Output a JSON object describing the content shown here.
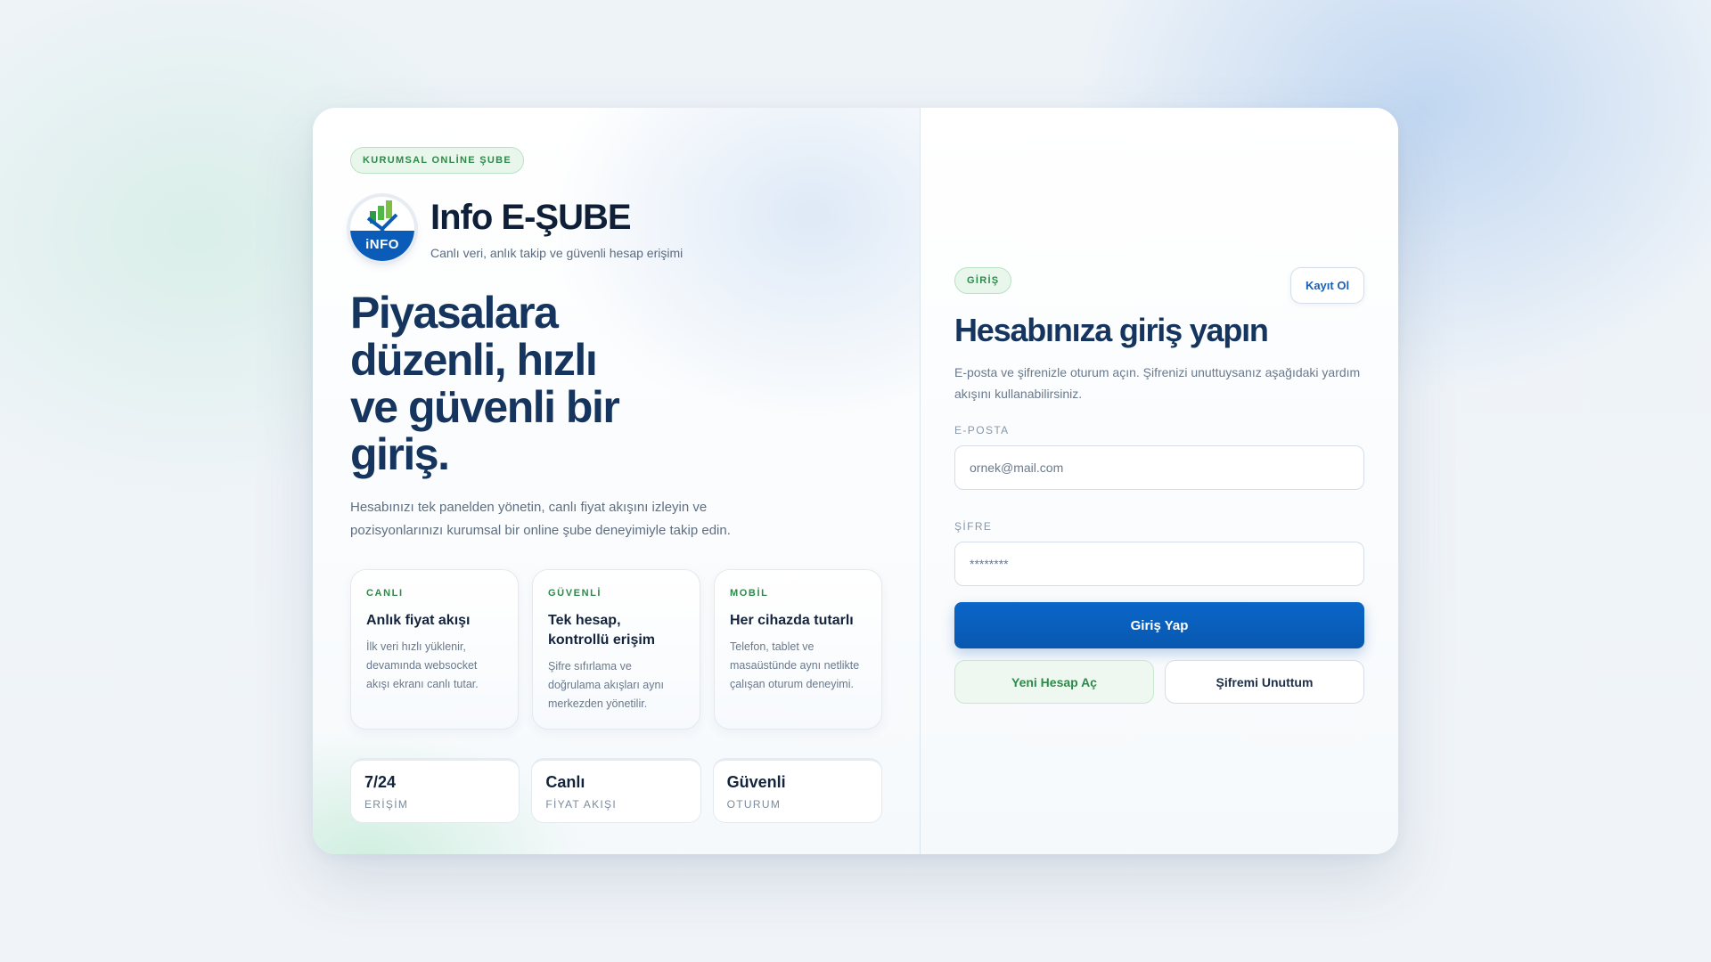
{
  "left": {
    "badge": "KURUMSAL ONLİNE ŞUBE",
    "brand": {
      "logo_text": "iNFO",
      "title": "Info E-ŞUBE",
      "subtitle": "Canlı veri, anlık takip ve güvenli hesap erişimi"
    },
    "hero_lines": [
      "Piyasalara",
      "düzenli, hızlı",
      "ve güvenli bir",
      "giriş."
    ],
    "lead": "Hesabınızı tek panelden yönetin, canlı fiyat akışını izleyin ve pozisyonlarınızı kurumsal bir online şube deneyimiyle takip edin.",
    "features": [
      {
        "tag": "CANLI",
        "title": "Anlık fiyat akışı",
        "desc": "İlk veri hızlı yüklenir, devamında websocket akışı ekranı canlı tutar."
      },
      {
        "tag": "GÜVENLİ",
        "title": "Tek hesap, kontrollü erişim",
        "desc": "Şifre sıfırlama ve doğrulama akışları aynı merkezden yönetilir."
      },
      {
        "tag": "MOBİL",
        "title": "Her cihazda tutarlı",
        "desc": "Telefon, tablet ve masaüstünde aynı netlikte çalışan oturum deneyimi."
      }
    ],
    "stats": [
      {
        "value": "7/24",
        "label": "ERİŞİM"
      },
      {
        "value": "Canlı",
        "label": "FİYAT AKIŞI"
      },
      {
        "value": "Güvenli",
        "label": "OTURUM"
      }
    ]
  },
  "form": {
    "badge": "GİRİŞ",
    "signup_label": "Kayıt Ol",
    "title": "Hesabınıza giriş yapın",
    "description": "E-posta ve şifrenizle oturum açın. Şifrenizi unuttuysanız aşağıdaki yardım akışını kullanabilirsiniz.",
    "email": {
      "label": "E-POSTA",
      "placeholder": "ornek@mail.com"
    },
    "password": {
      "label": "ŞİFRE",
      "placeholder": "********"
    },
    "submit_label": "Giriş Yap",
    "new_account_label": "Yeni Hesap Aç",
    "forgot_label": "Şifremi Unuttum"
  },
  "colors": {
    "primary": "#0b66c8",
    "accent_green": "#2e8a4a",
    "heading": "#16355e"
  }
}
